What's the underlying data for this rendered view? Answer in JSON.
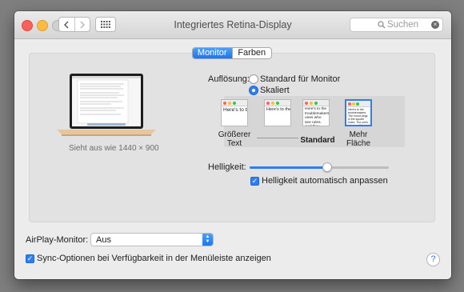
{
  "window": {
    "title": "Integriertes Retina-Display"
  },
  "toolbar": {
    "search_placeholder": "Suchen"
  },
  "tabs": [
    {
      "label": "Monitor",
      "selected": true
    },
    {
      "label": "Farben",
      "selected": false
    }
  ],
  "preview": {
    "caption": "Sieht aus wie 1440 × 900"
  },
  "resolution": {
    "label": "Auflösung:",
    "options": [
      {
        "label": "Standard für Monitor",
        "selected": false
      },
      {
        "label": "Skaliert",
        "selected": true
      }
    ],
    "scales": [
      {
        "label": "Größerer Text",
        "sample": "Here's to the troublemak",
        "selected": false
      },
      {
        "label": "",
        "sample": "Here's to the troublemakers ones who",
        "selected": false
      },
      {
        "label": "Standard",
        "sample": "Here's to the troublemakers ones who see rules. And they",
        "selected": false
      },
      {
        "label": "Mehr Fläche",
        "sample": "Here's to the troublemakers. The round pegs in the square holes. The ones who see things differently.",
        "selected": true
      }
    ]
  },
  "brightness": {
    "label": "Helligkeit:",
    "level_percent": 56,
    "auto_label": "Helligkeit automatisch anpassen",
    "auto_checked": true
  },
  "airplay": {
    "label": "AirPlay-Monitor:",
    "value": "Aus"
  },
  "sync": {
    "label": "Sync-Optionen bei Verfügbarkeit in der Menüleiste anzeigen",
    "checked": true
  },
  "help": {
    "symbol": "?"
  },
  "colors": {
    "accent": "#2f7df5",
    "close": "#fc605c",
    "minimize": "#fdbc40"
  }
}
